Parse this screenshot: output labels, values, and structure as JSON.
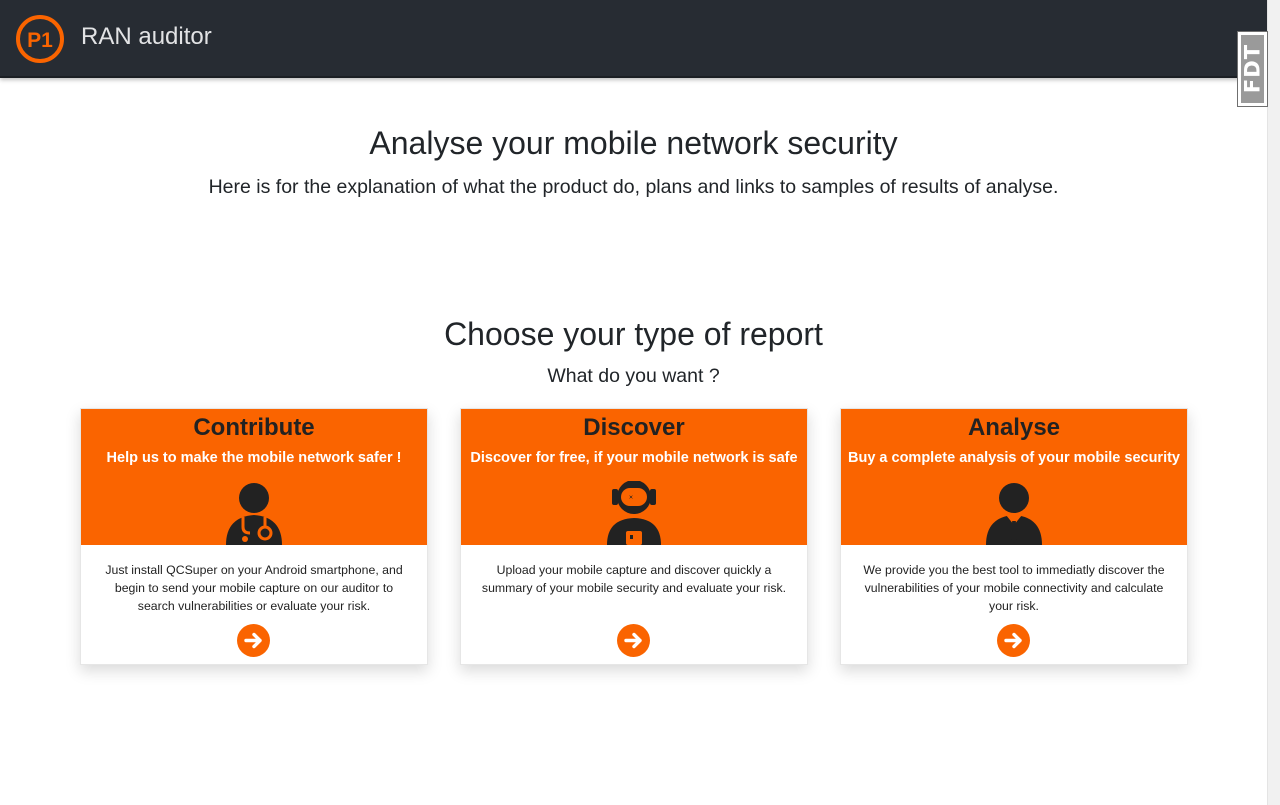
{
  "navbar": {
    "logo_text": "P1",
    "brand_name": "RAN auditor"
  },
  "side_tab": {
    "label": "FDT"
  },
  "hero": {
    "title": "Analyse your mobile network security",
    "text": "Here is for the explanation of what the product do, plans and links to samples of results of analyse."
  },
  "report_section": {
    "title": "Choose your type of report",
    "subtitle": "What do you want ?"
  },
  "cards": [
    {
      "title": "Contribute",
      "subtitle": "Help us to make the mobile network safer !",
      "icon": "doctor-user-icon",
      "description": "Just install QCSuper on your Android smartphone, and begin to send your mobile capture on our auditor to search vulnerabilities or evaluate your risk."
    },
    {
      "title": "Discover",
      "subtitle": "Discover for free, if your mobile network is safe",
      "icon": "astronaut-user-icon",
      "description": "Upload your mobile capture and discover quickly a summary of your mobile security and evaluate your risk."
    },
    {
      "title": "Analyse",
      "subtitle": "Buy a complete analysis of your mobile security",
      "icon": "business-user-icon",
      "description": "We provide you the best tool to immediatly discover the vulnerabilities of your mobile connectivity and calculate your risk."
    }
  ],
  "colors": {
    "accent": "#fa6400",
    "navbar": "#272c33",
    "heading": "#212529"
  }
}
